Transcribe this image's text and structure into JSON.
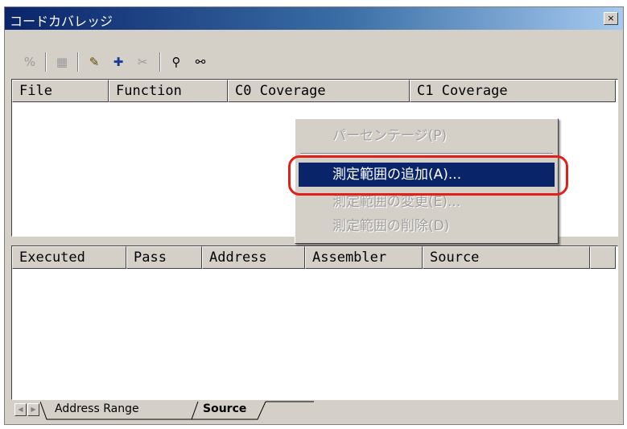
{
  "window": {
    "title": "コードカバレッジ",
    "close_symbol": "×"
  },
  "toolbar": {
    "buttons": [
      {
        "name": "percent-icon",
        "glyph": "%"
      },
      {
        "name": "coverage-graph-icon",
        "glyph": "▦"
      },
      {
        "name": "edit-range-icon",
        "glyph": "✎"
      },
      {
        "name": "add-range-icon",
        "glyph": "✚"
      },
      {
        "name": "delete-range-icon",
        "glyph": "✂"
      },
      {
        "name": "find-icon",
        "glyph": "⚲"
      },
      {
        "name": "find-next-icon",
        "glyph": "⚯"
      }
    ]
  },
  "top_table": {
    "columns": [
      "File",
      "Function",
      "C0 Coverage",
      "C1 Coverage"
    ]
  },
  "bottom_table": {
    "columns": [
      "Executed",
      "Pass",
      "Address",
      "Assembler",
      "Source"
    ]
  },
  "tabs": {
    "items": [
      "Address Range",
      "Source"
    ],
    "active": "Source"
  },
  "context_menu": {
    "items": [
      {
        "label": "パーセンテージ(P)",
        "state": "disabled"
      },
      {
        "label": "測定範囲の追加(A)...",
        "state": "selected"
      },
      {
        "label": "測定範囲の変更(E)...",
        "state": "disabled"
      },
      {
        "label": "測定範囲の削除(D)",
        "state": "disabled"
      }
    ]
  },
  "colors": {
    "title_bar": "#0a246a",
    "selection": "#0a246a",
    "highlight_ring": "#e0201a",
    "face": "#d4d0c8"
  }
}
